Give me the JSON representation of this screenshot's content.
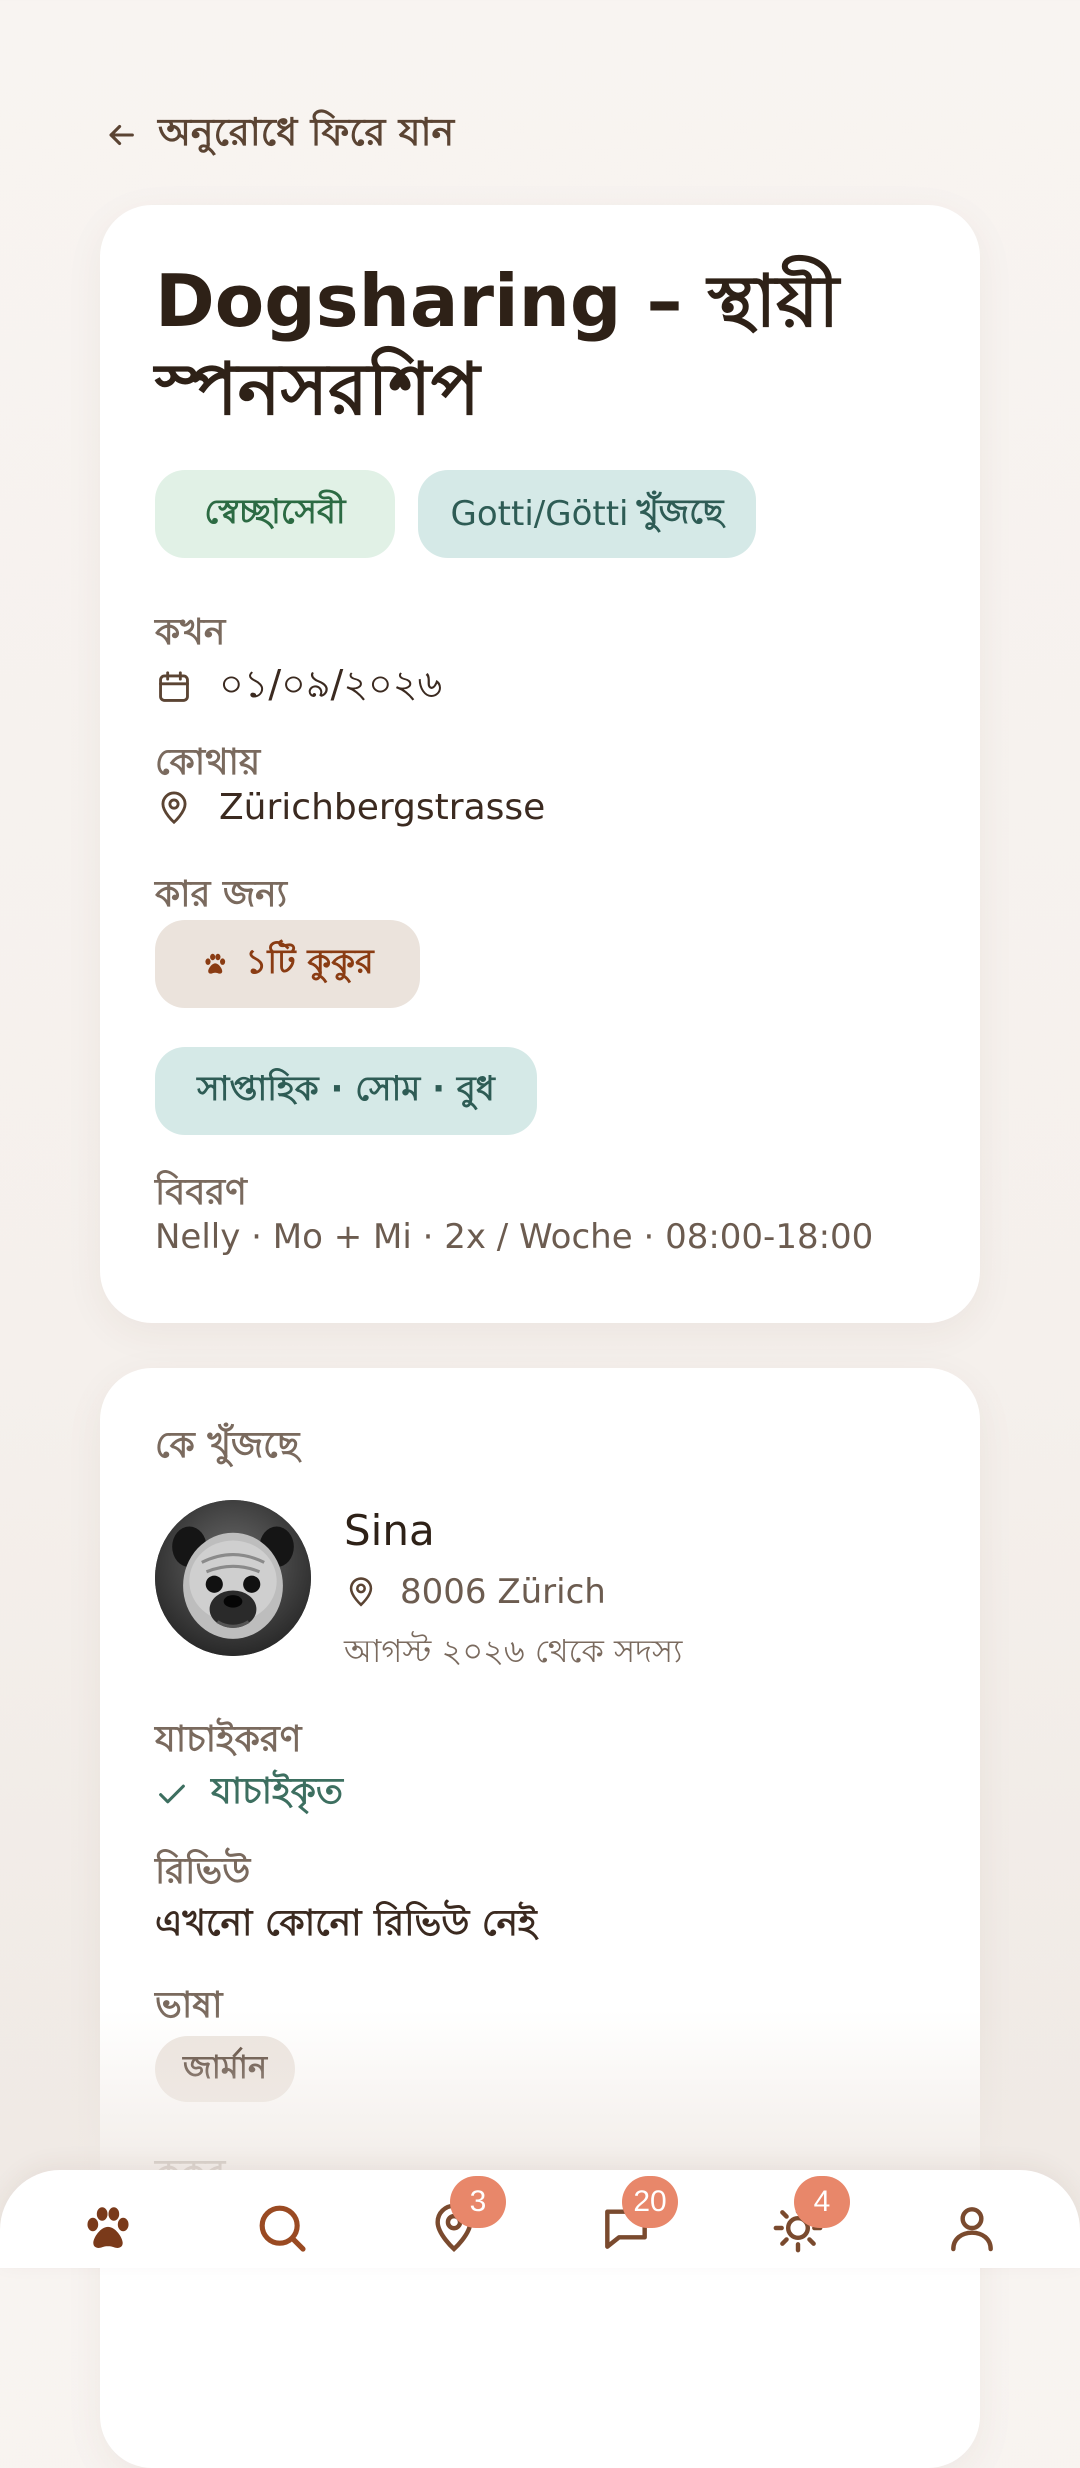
{
  "back": {
    "label": "অনুরোধে ফিরে যান"
  },
  "listing": {
    "title": "Dogsharing – স্থায়ী স্পনসরশিপ",
    "chips": {
      "volunteer": "স্বেচ্ছাসেবী",
      "seeking_prefix": "Gotti/Götti",
      "seeking_suffix": "খুঁজছে"
    },
    "when_label": "কখন",
    "date": "০১/০৯/২০২৬",
    "where_label": "কোথায়",
    "location": "Zürichbergstrasse",
    "for_label": "কার জন্য",
    "dogs": "১টি কুকুর",
    "schedule": "সাপ্তাহিক · সোম · বুধ",
    "description_label": "বিবরণ",
    "description": "Nelly · Mo + Mi · 2x / Woche · 08:00-18:00"
  },
  "owner": {
    "section_label": "কে খুঁজছে",
    "name": "Sina",
    "location": "8006 Zürich",
    "member_since": "আগস্ট ২০২৬ থেকে সদস্য",
    "verification_label": "যাচাইকরণ",
    "verification_status": "যাচাইকৃত",
    "reviews_label": "রিভিউ",
    "reviews_text": "এখনো কোনো রিভিউ নেই",
    "language_label": "ভাষা",
    "language": "জার্মান",
    "dogs_label": "কুকুর"
  },
  "tabbar": {
    "tabs": [
      {
        "icon": "paw-icon",
        "badge": ""
      },
      {
        "icon": "search-icon",
        "badge": ""
      },
      {
        "icon": "map-pin-icon",
        "badge": "3"
      },
      {
        "icon": "chat-icon",
        "badge": "20"
      },
      {
        "icon": "sun-icon",
        "badge": "4"
      },
      {
        "icon": "profile-icon",
        "badge": ""
      }
    ]
  },
  "colors": {
    "accent_brown": "#8a3c13",
    "badge": "#e8876a",
    "volunteer_chip": "#e1f1e6",
    "teal_chip": "#d5e9e7"
  }
}
